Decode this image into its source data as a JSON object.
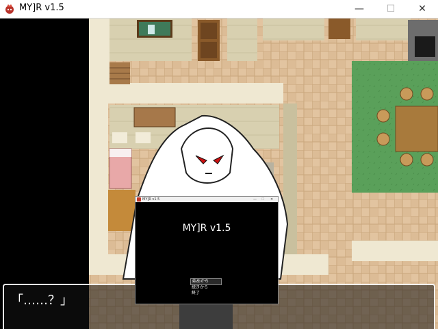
{
  "window": {
    "title": "MY]R v1.5",
    "minimize_glyph": "—",
    "maximize_glyph": "☐",
    "close_glyph": "✕"
  },
  "dialog": {
    "text": "「……？」"
  },
  "mini_window": {
    "title": "MY]R v1.5",
    "game_title": "MY]R v1.5",
    "minimize_glyph": "—",
    "maximize_glyph": "☐",
    "close_glyph": "✕",
    "menu": [
      "始めから",
      "続きから",
      "終了"
    ]
  },
  "icons": [
    "app-icon",
    "mini-app-icon"
  ],
  "colors": {
    "floor_tile": "#e2c4a0",
    "carpet": "#5aa05a",
    "wall": "#d8d0b0",
    "table": "#a87a3c",
    "character_eyes": "#cc1111"
  }
}
